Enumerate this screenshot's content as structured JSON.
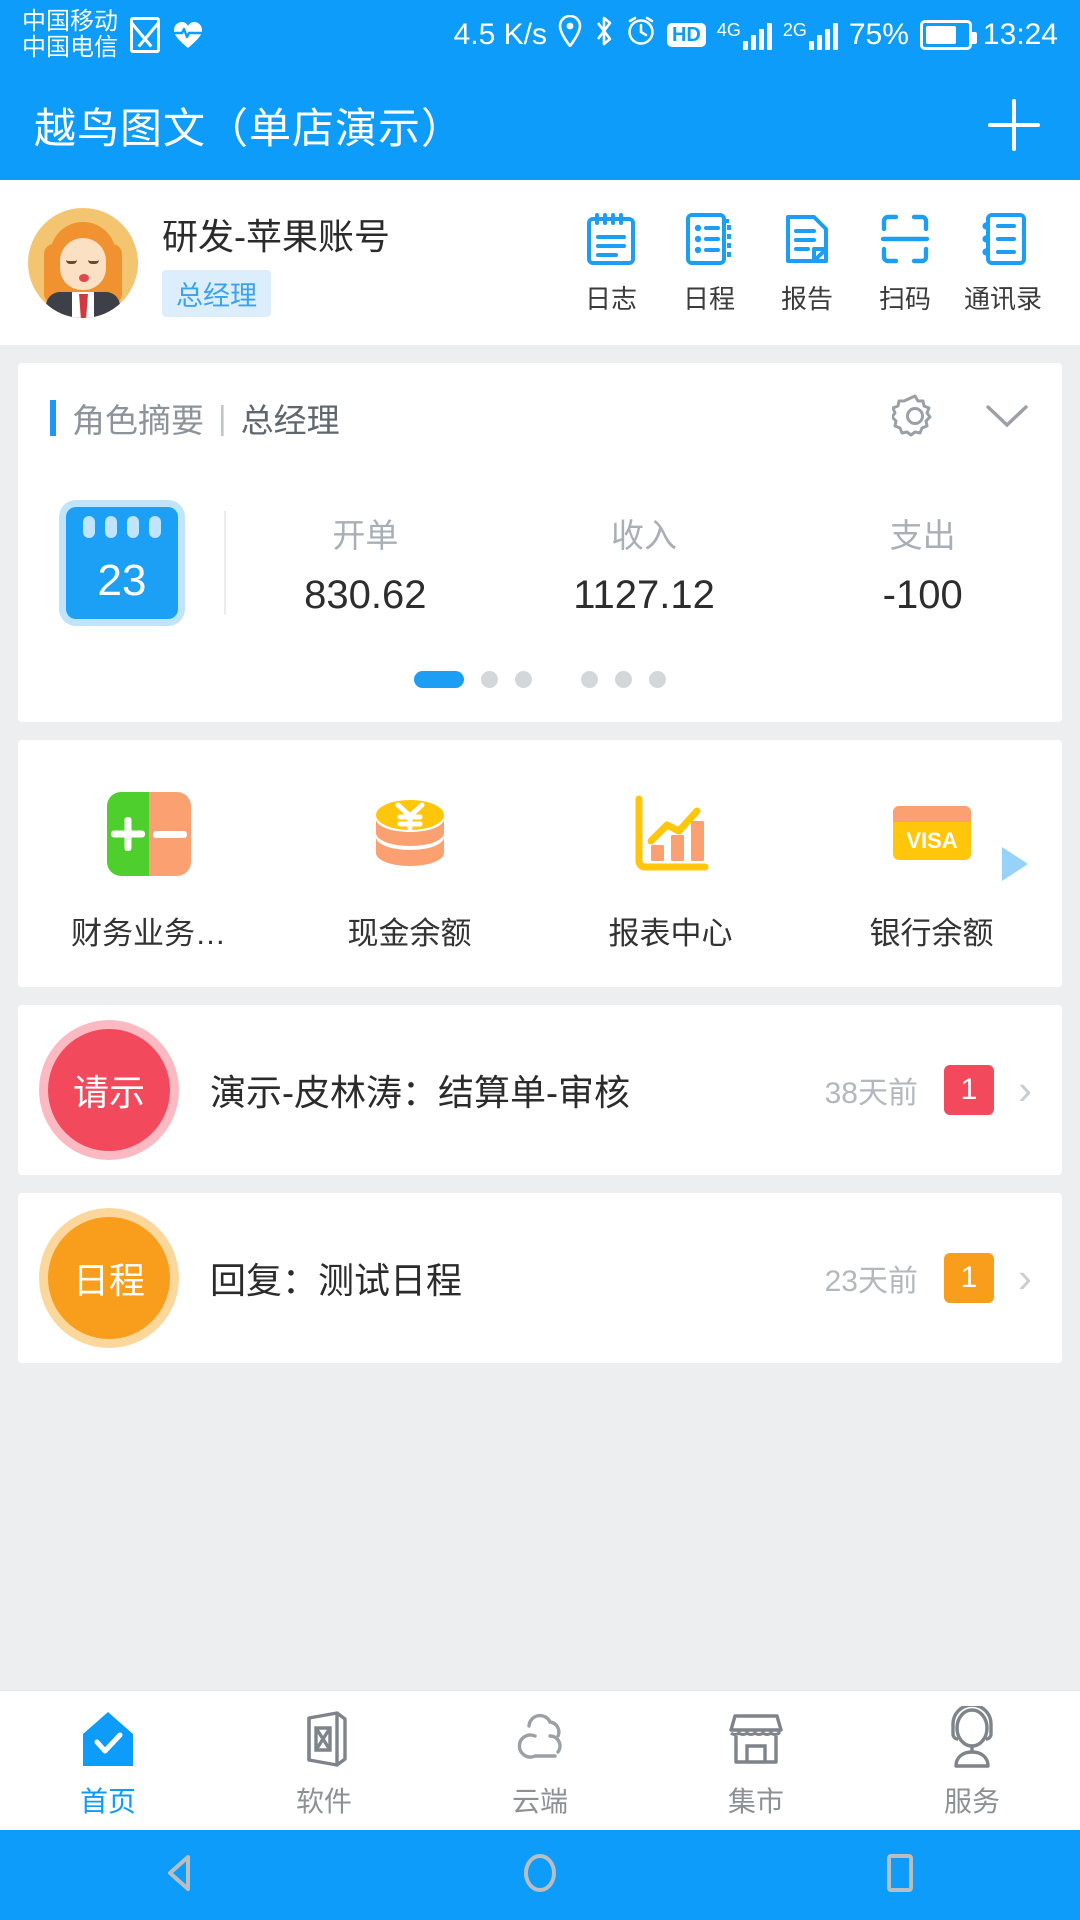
{
  "status_bar": {
    "carrier_line1": "中国移动",
    "carrier_line2": "中国电信",
    "net_speed": "4.5 K/s",
    "hd_label": "HD",
    "sim1_net": "4G",
    "sim2_net": "2G",
    "battery_percent": "75%",
    "time": "13:24",
    "icons": [
      "envelope-icon",
      "heartbeat-icon",
      "location-icon",
      "bluetooth-icon",
      "alarm-icon"
    ],
    "accent": "#0d9cf9"
  },
  "app_bar": {
    "title": "越鸟图文（单店演示）",
    "add_label": "+"
  },
  "profile": {
    "name": "研发-苹果账号",
    "role_badge": "总经理",
    "avatar_name": "user-avatar",
    "quick_actions": [
      {
        "label": "日志",
        "icon": "notepad-icon"
      },
      {
        "label": "日程",
        "icon": "agenda-icon"
      },
      {
        "label": "报告",
        "icon": "report-icon"
      },
      {
        "label": "扫码",
        "icon": "scan-icon"
      },
      {
        "label": "通讯录",
        "icon": "contacts-icon"
      }
    ]
  },
  "summary_card": {
    "title": "角色摘要",
    "separator": "|",
    "subtitle": "总经理",
    "settings_icon": "gear-icon",
    "collapse_icon": "chevron-down-icon",
    "calendar_day": "23",
    "stats": [
      {
        "label": "开单",
        "value": "830.62"
      },
      {
        "label": "收入",
        "value": "1127.12"
      },
      {
        "label": "支出",
        "value": "-100"
      }
    ],
    "pagination": {
      "total_group1": 3,
      "total_group2": 3,
      "active_index": 0
    }
  },
  "function_grid": {
    "items": [
      {
        "label": "财务业务…",
        "icon": "plus-minus-icon"
      },
      {
        "label": "现金余额",
        "icon": "coins-icon"
      },
      {
        "label": "报表中心",
        "icon": "bar-chart-icon"
      },
      {
        "label": "银行余额",
        "icon": "visa-card-icon",
        "card_text": "VISA"
      }
    ],
    "next_icon": "next-arrow-icon"
  },
  "messages": [
    {
      "badge": "请示",
      "badge_color": "red",
      "title": "演示-皮林涛：结算单-审核",
      "time": "38天前",
      "count": "1",
      "chevron": "›"
    },
    {
      "badge": "日程",
      "badge_color": "orange",
      "title": "回复：测试日程",
      "time": "23天前",
      "count": "1",
      "chevron": "›"
    }
  ],
  "tab_bar": {
    "items": [
      {
        "label": "首页",
        "icon": "home-check-icon",
        "active": true
      },
      {
        "label": "软件",
        "icon": "box-icon",
        "active": false
      },
      {
        "label": "云端",
        "icon": "cloud-icon",
        "active": false
      },
      {
        "label": "集市",
        "icon": "shop-icon",
        "active": false
      },
      {
        "label": "服务",
        "icon": "headset-icon",
        "active": false
      }
    ]
  },
  "system_nav": {
    "back_icon": "back-triangle-icon",
    "home_icon": "home-circle-icon",
    "recents_icon": "recents-square-icon"
  }
}
